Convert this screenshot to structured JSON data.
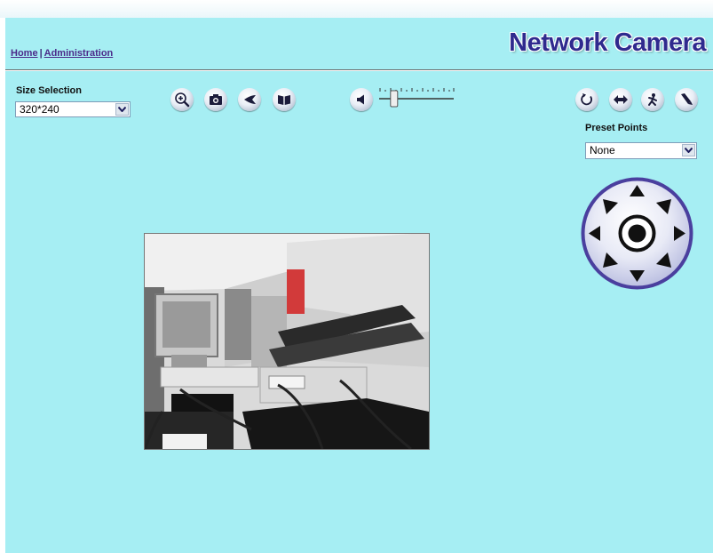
{
  "nav": {
    "home_label": "Home",
    "separator": "|",
    "admin_label": "Administration"
  },
  "brand": {
    "title": "Network Camera"
  },
  "size_selection": {
    "label": "Size Selection",
    "value": "320*240"
  },
  "toolbar": {
    "icons": [
      "zoom-in-icon",
      "camera-snapshot-icon",
      "rewind-icon",
      "book-icon",
      "speaker-icon"
    ]
  },
  "volume": {
    "level": 0.2
  },
  "ptz_tools": {
    "icons": [
      "rotate-icon",
      "horizontal-scan-icon",
      "patrol-icon",
      "brush-icon"
    ]
  },
  "preset_points": {
    "label": "Preset Points",
    "value": "None"
  },
  "colors": {
    "background": "#a6eef3",
    "brand": "#2f2a8e",
    "link": "#4b2a8a",
    "ptz_ring": "#4a3f9e"
  }
}
